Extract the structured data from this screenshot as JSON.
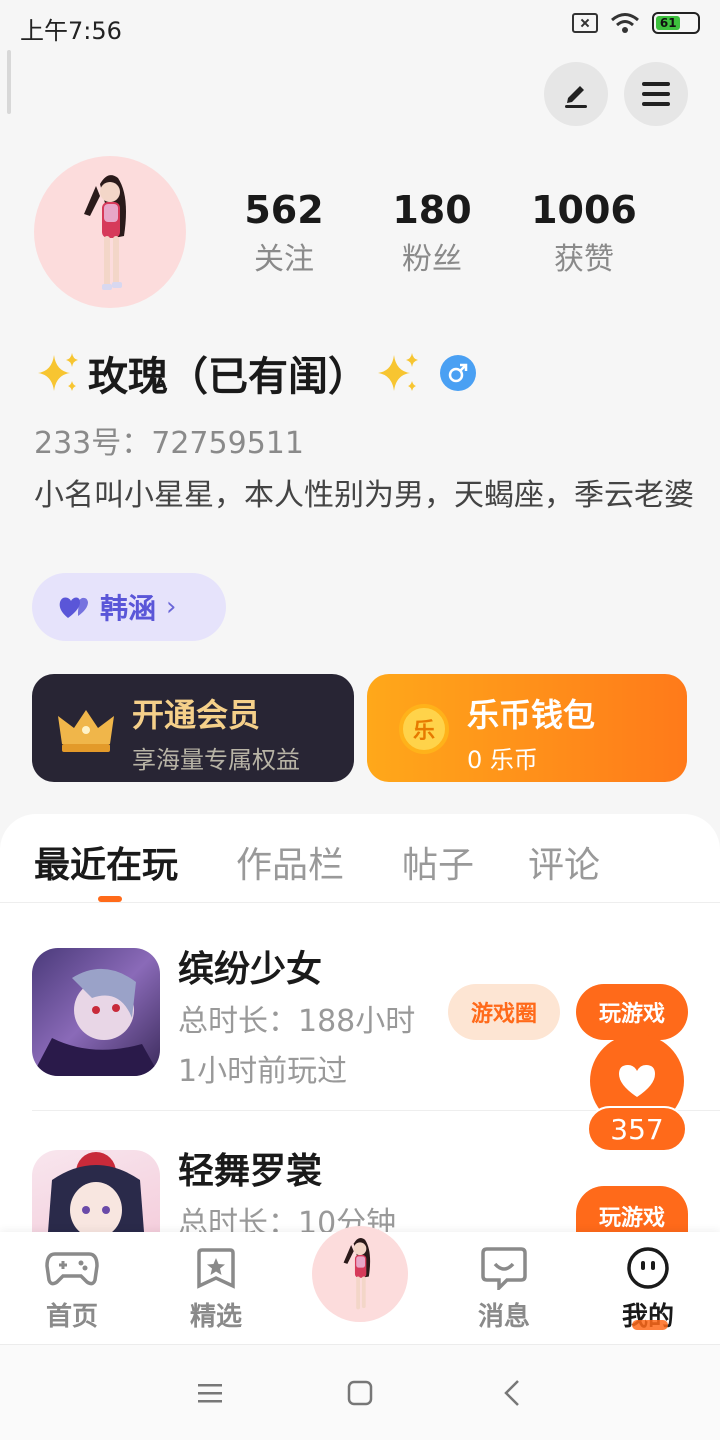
{
  "status_bar": {
    "time": "上午7:56",
    "battery": "61"
  },
  "header": {
    "edit_icon": "edit-icon",
    "menu_icon": "menu-icon"
  },
  "profile": {
    "stats": [
      {
        "value": "562",
        "label": "关注"
      },
      {
        "value": "180",
        "label": "粉丝"
      },
      {
        "value": "1006",
        "label": "获赞"
      }
    ],
    "name": "玫瑰（已有闺）",
    "uid": "233号：72759511",
    "bio": "小名叫小星星，本人性别为男，天蝎座，季云老婆",
    "tag": "韩涵"
  },
  "cards": {
    "vip": {
      "title": "开通会员",
      "subtitle": "享海量专属权益"
    },
    "wallet": {
      "title": "乐币钱包",
      "subtitle": "0 乐币",
      "coin_symbol": "乐"
    }
  },
  "tabs": [
    "最近在玩",
    "作品栏",
    "帖子",
    "评论"
  ],
  "games": [
    {
      "name": "缤纷少女",
      "duration": "总时长：188小时",
      "last_played": "1小时前玩过",
      "circle_label": "游戏圈",
      "play_label": "玩游戏"
    },
    {
      "name": "轻舞罗裳",
      "duration": "总时长：10分钟",
      "play_label": "玩游戏"
    }
  ],
  "float_like": {
    "count": "357"
  },
  "bottom_nav": [
    {
      "label": "首页",
      "icon": "gamepad-icon"
    },
    {
      "label": "精选",
      "icon": "star-bookmark-icon"
    },
    {
      "label": "消息",
      "icon": "chat-bubble-icon"
    },
    {
      "label": "我的",
      "icon": "face-icon"
    }
  ],
  "colors": {
    "accent": "#ff6a1a",
    "tag_purple": "#5a56d8",
    "vip_gold": "#f5d08a"
  }
}
